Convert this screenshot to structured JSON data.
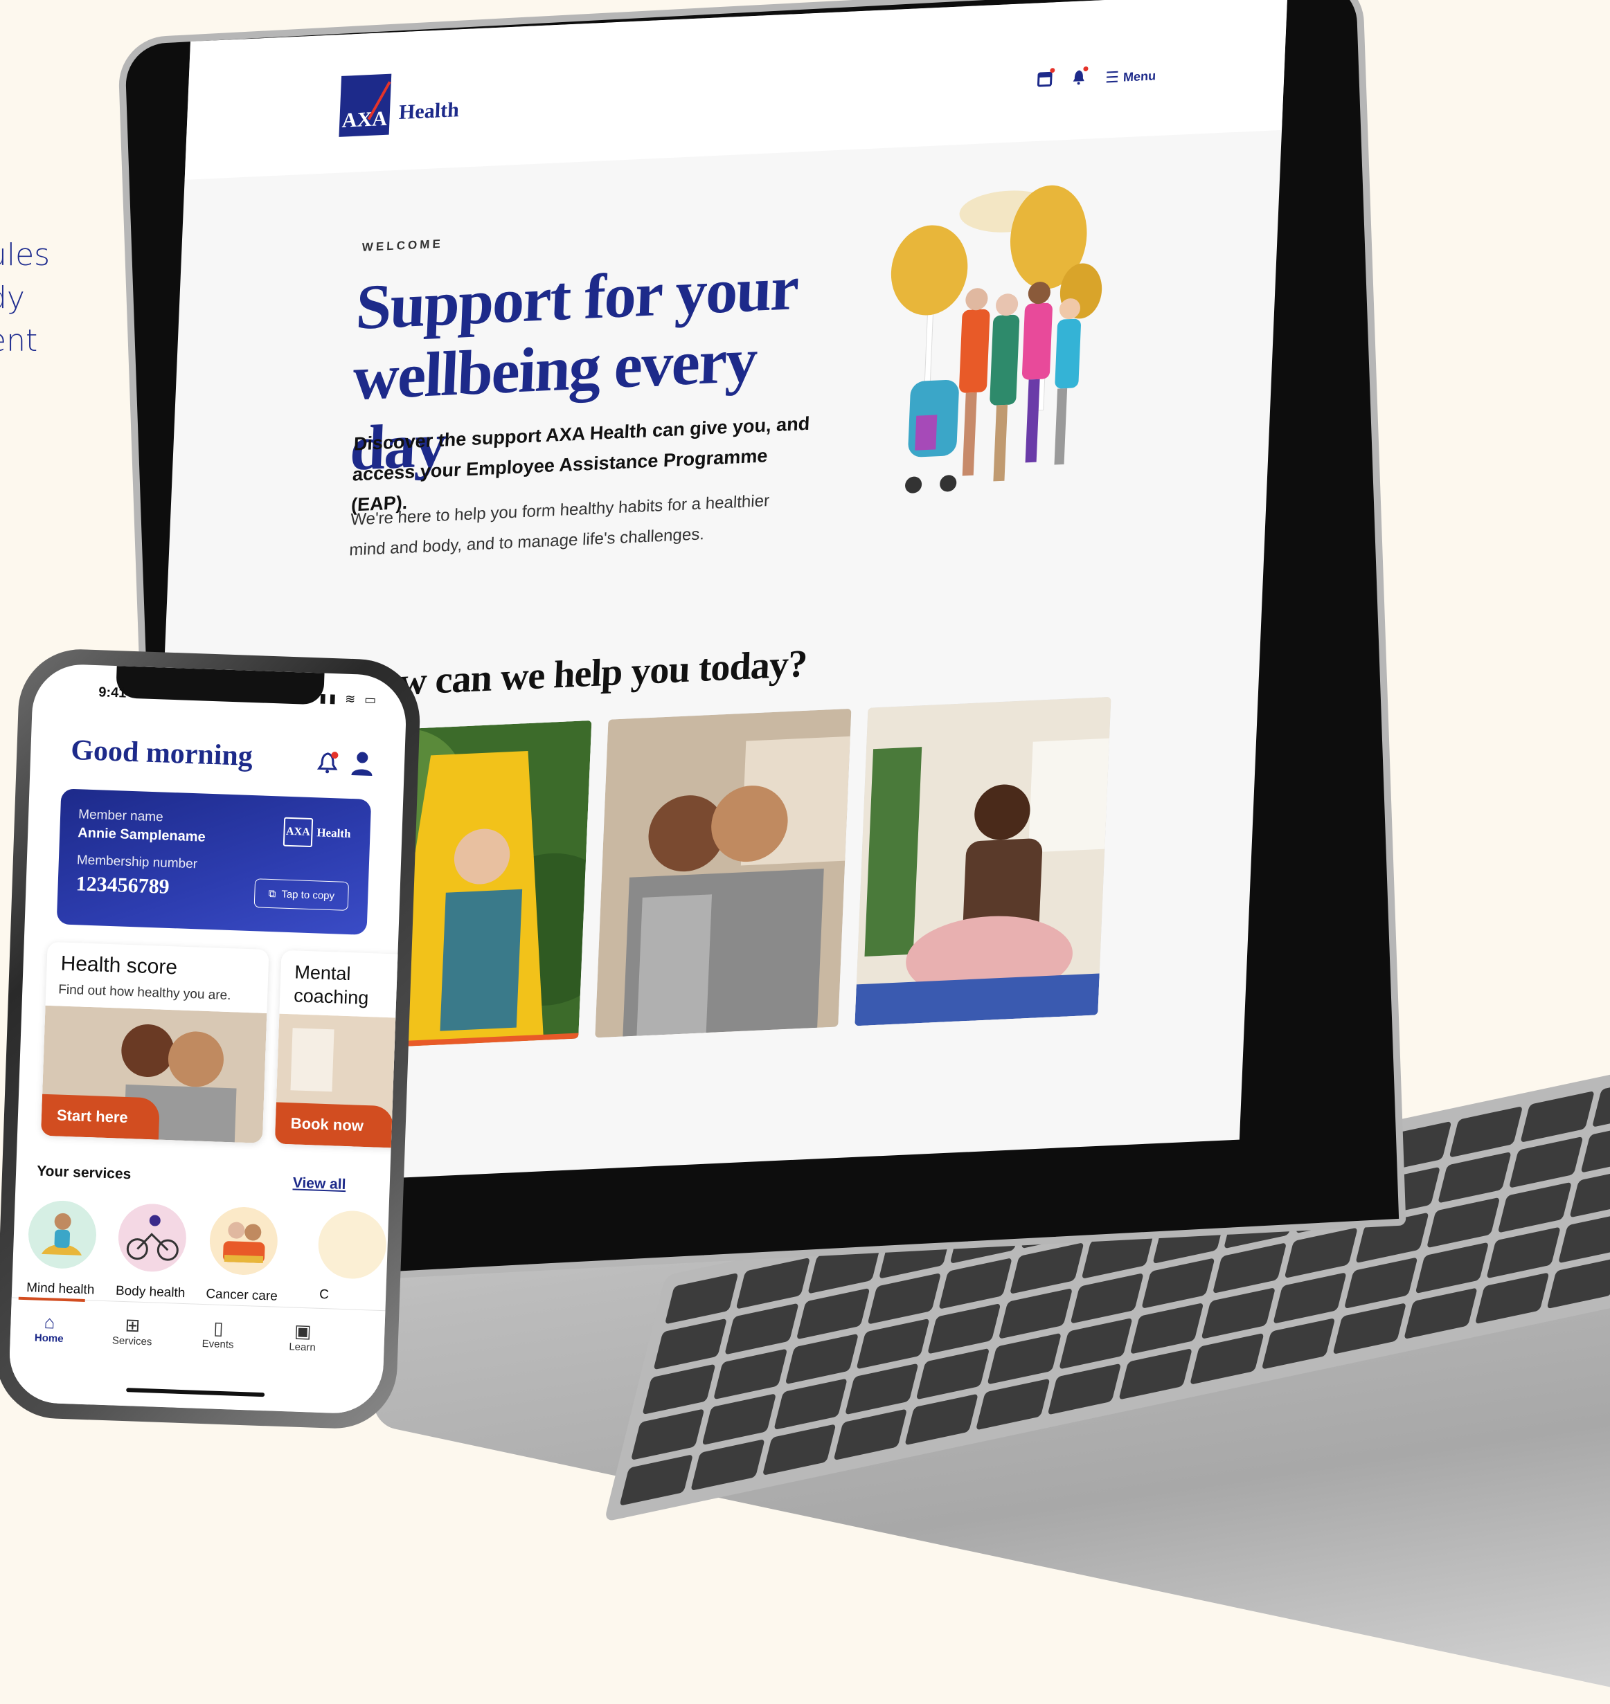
{
  "side_text": [
    "ules",
    "dy",
    "ent"
  ],
  "desktop": {
    "logo_mark": "AXA",
    "logo_word": "Health",
    "nav_icons": [
      "calendar-icon",
      "bell-icon",
      "menu-icon"
    ],
    "menu_label": "Menu",
    "welcome": "WELCOME",
    "headline": "Support for your wellbeing every day",
    "subtitle": "Discover the support AXA Health can give you, and access your Employee Assistance Programme (EAP).",
    "body": "We're here to help you form healthy habits for a healthier mind and body, and to manage life's challenges.",
    "help_title": "How can we help you today?"
  },
  "phone": {
    "time": "9:41",
    "greeting": "Good morning",
    "member_card": {
      "member_label": "Member name",
      "member_name": "Annie Samplename",
      "number_label": "Membership number",
      "number": "123456789",
      "logo_mark": "AXA",
      "logo_word": "Health",
      "copy_label": "Tap to copy"
    },
    "tiles": [
      {
        "title": "Health score",
        "desc": "Find out how healthy you are.",
        "button": "Start here"
      },
      {
        "title": "Mental coaching",
        "desc": "",
        "button": "Book now"
      }
    ],
    "services_title": "Your services",
    "view_all": "View all",
    "services": [
      "Mind health",
      "Body health",
      "Cancer care",
      "C"
    ],
    "tabs": [
      "Home",
      "Services",
      "Events",
      "Learn"
    ]
  },
  "colors": {
    "brand": "#1d2a8a",
    "accent": "#d24d20",
    "background": "#fdf8ee"
  }
}
